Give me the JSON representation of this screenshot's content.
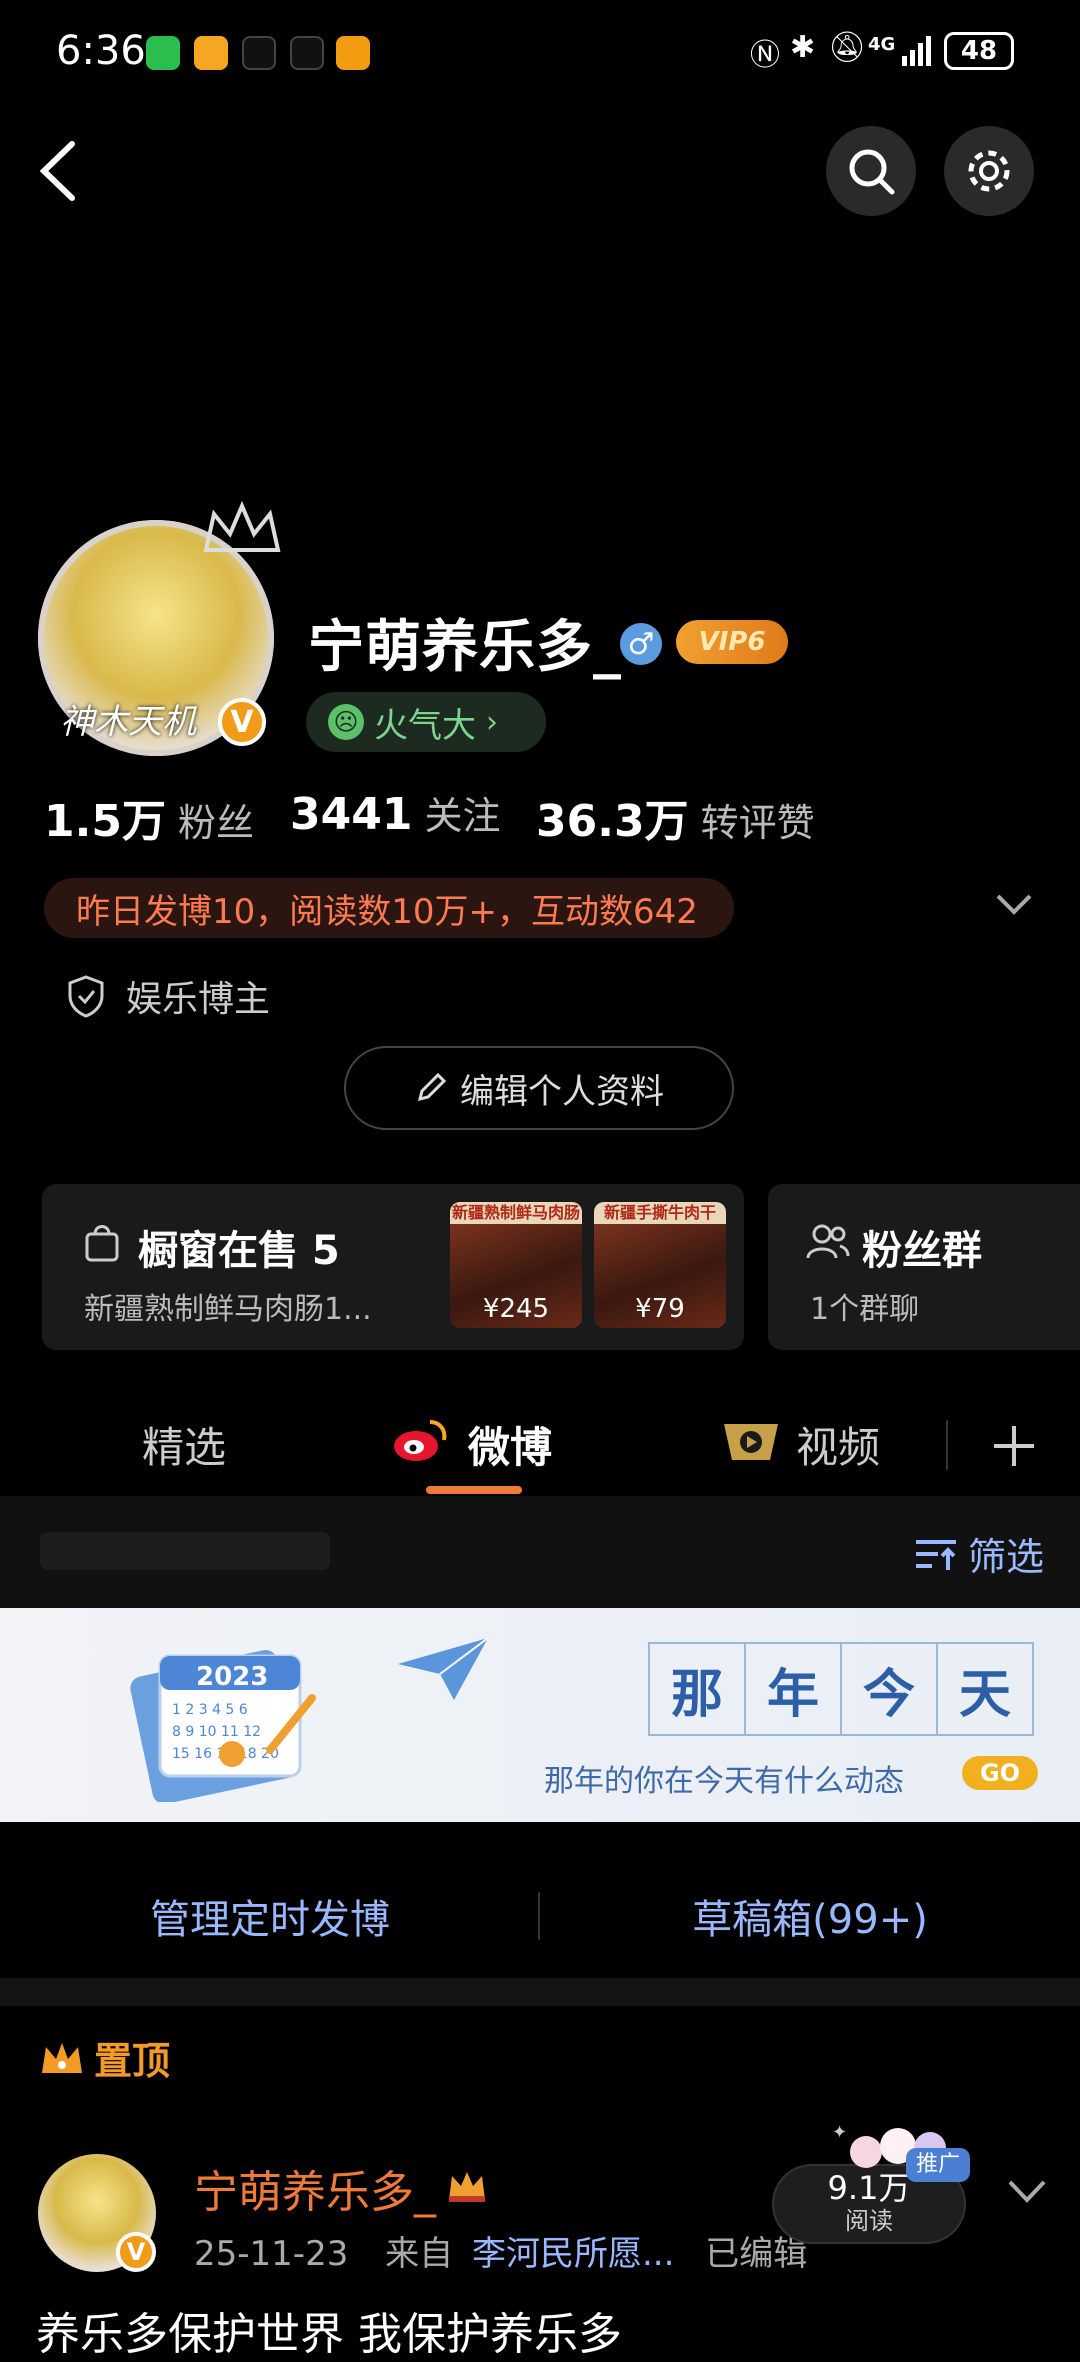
{
  "status_bar": {
    "time": "6:36",
    "battery": "48",
    "network": "4G"
  },
  "profile": {
    "username": "宁萌养乐多_",
    "vip": "VIP6",
    "gender_symbol": "♂",
    "mood": "火气大",
    "avatar_caption": "神木天机",
    "stats": [
      {
        "value": "1.5万",
        "label": "粉丝"
      },
      {
        "value": "3441",
        "label": "关注"
      },
      {
        "value": "36.3万",
        "label": "转评赞"
      }
    ],
    "highlight": "昨日发博10，阅读数10万+，互动数642",
    "role": "娱乐博主",
    "edit_label": "编辑个人资料"
  },
  "shop": {
    "title": "橱窗在售 5",
    "subtitle": "新疆熟制鲜马肉肠1...",
    "products": [
      {
        "tag": "新疆熟制鲜马肉肠",
        "price": "¥245"
      },
      {
        "tag": "新疆手撕牛肉干",
        "price": "¥79"
      }
    ]
  },
  "fans_group": {
    "title": "粉丝群",
    "subtitle": "1个群聊"
  },
  "tabs": [
    {
      "label": "精选"
    },
    {
      "label": "微博"
    },
    {
      "label": "视频"
    }
  ],
  "filter_label": "筛选",
  "banner": {
    "title_chars": [
      "那",
      "年",
      "今",
      "天"
    ],
    "subtitle": "那年的你在今天有什么动态",
    "go": "GO",
    "calendar_year": "2023"
  },
  "actions": {
    "scheduled": "管理定时发博",
    "drafts": "草稿箱(99+)"
  },
  "pinned_label": "置顶",
  "post": {
    "author": "宁萌养乐多_",
    "date": "25-11-23",
    "source_prefix": "来自",
    "source": "李河民所愿...",
    "edited": "已编辑",
    "reads_value": "9.1万",
    "reads_label": "阅读",
    "promo": "推广",
    "text": "养乐多保护世界 我保护养乐多"
  },
  "colors": {
    "accent": "#f07a3a",
    "link": "#9ab8ff",
    "vip": "#f0a030"
  }
}
